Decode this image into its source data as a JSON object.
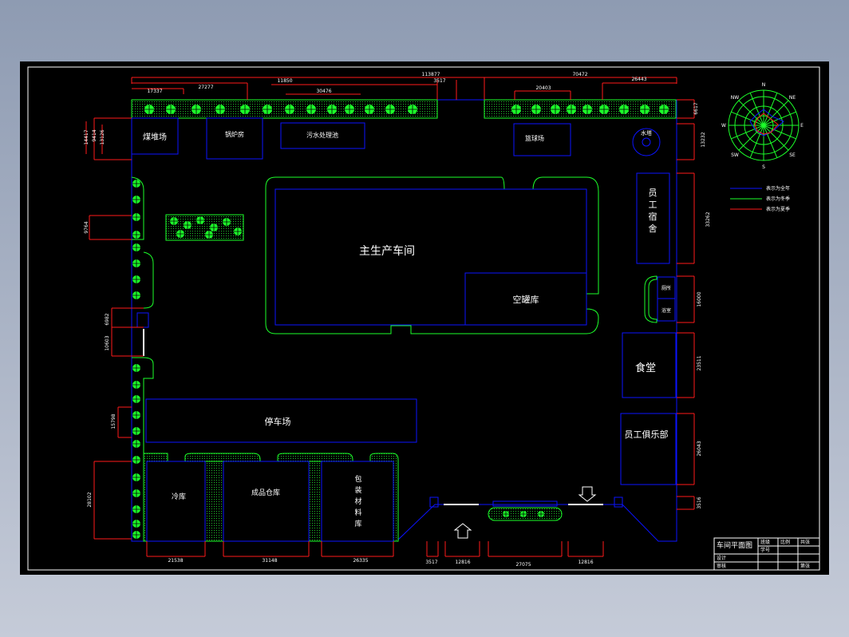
{
  "buildings": {
    "coal_yard": "煤堆场",
    "boiler_room": "锅炉房",
    "sewage": "污水处理池",
    "court": "篮球场",
    "water_tower": "水塔",
    "main_workshop": "主生产车间",
    "empty_tank": "空罐库",
    "dorm": [
      "员",
      "工",
      "宿",
      "舍"
    ],
    "bath": "浴室",
    "toilet": "厕所",
    "canteen": "食堂",
    "club": "员工俱乐部",
    "parking": "停车场",
    "cold_storage": "冷库",
    "product_warehouse": "成品仓库",
    "packaging": [
      "包",
      "装",
      "材",
      "料",
      "库"
    ]
  },
  "dimensions": {
    "total_top": "113877",
    "top_a": "17337",
    "top_b": "27277",
    "top_c": "11850",
    "top_d": "30476",
    "top_e": "3517",
    "top_f": "70472",
    "top_g": "20403",
    "top_h": "26443",
    "left_a": "14417",
    "left_b": "9414",
    "left_c": "13126",
    "left_d": "9764",
    "left_e": "6982",
    "left_f": "10603",
    "left_g": "15798",
    "left_h": "28102",
    "right_a": "6617",
    "right_b": "13232",
    "right_c": "33262",
    "right_d": "16000",
    "right_e": "23511",
    "right_f": "26043",
    "right_g": "3516",
    "bottom_a": "21538",
    "bottom_b": "31148",
    "bottom_c": "26335",
    "bottom_d": "3517",
    "bottom_e": "12816",
    "bottom_f": "27075",
    "bottom_g": "12816"
  },
  "compass": {
    "n": "N",
    "ne": "NE",
    "e": "E",
    "se": "SE",
    "s": "S",
    "sw": "SW",
    "w": "W",
    "nw": "NW"
  },
  "legend": [
    "表示为全年",
    "表示为冬季",
    "表示为夏季"
  ],
  "title_block": {
    "name": "车间平面图",
    "c1": "班级",
    "c2": "学号",
    "c3": "比例",
    "c4": "共张",
    "c5": "设计",
    "c6": "审核",
    "c7": "第张"
  },
  "colors": {
    "background": "#000000",
    "buildings": "#0b13ff",
    "greenery": "#1cff2a",
    "dimensions": "#ff1a1a",
    "text": "#ffffff"
  }
}
